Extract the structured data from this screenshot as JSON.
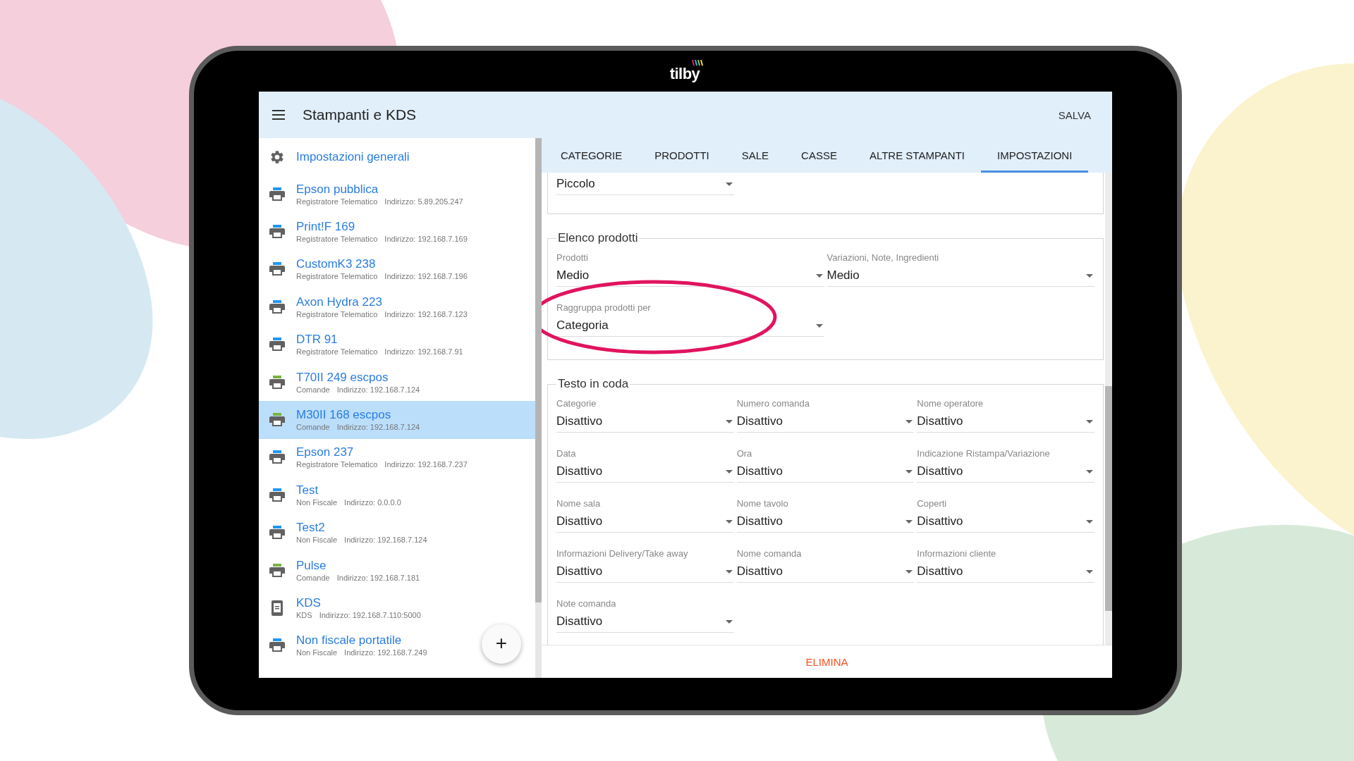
{
  "device_logo": "tilby",
  "app_bar": {
    "title": "Stampanti e KDS",
    "action": "SALVA"
  },
  "sidebar": {
    "items": [
      {
        "kind": "settings",
        "name": "Impostazioni generali",
        "selected": false
      },
      {
        "kind": "printer",
        "name": "Epson pubblica",
        "type": "Registratore Telematico",
        "address": "Indirizzo: 5.89.205.247",
        "color": "#2196f3",
        "selected": false
      },
      {
        "kind": "printer",
        "name": "Print!F 169",
        "type": "Registratore Telematico",
        "address": "Indirizzo: 192.168.7.169",
        "color": "#2196f3",
        "selected": false
      },
      {
        "kind": "printer",
        "name": "CustomK3 238",
        "type": "Registratore Telematico",
        "address": "Indirizzo: 192.168.7.196",
        "color": "#2196f3",
        "selected": false
      },
      {
        "kind": "printer",
        "name": "Axon Hydra 223",
        "type": "Registratore Telematico",
        "address": "Indirizzo: 192.168.7.123",
        "color": "#2196f3",
        "selected": false
      },
      {
        "kind": "printer",
        "name": "DTR 91",
        "type": "Registratore Telematico",
        "address": "Indirizzo: 192.168.7.91",
        "color": "#2196f3",
        "selected": false
      },
      {
        "kind": "printer",
        "name": "T70II 249 escpos",
        "type": "Comande",
        "address": "Indirizzo: 192.168.7.124",
        "color": "#7cb342",
        "selected": false
      },
      {
        "kind": "printer",
        "name": "M30II 168 escpos",
        "type": "Comande",
        "address": "Indirizzo: 192.168.7.124",
        "color": "#7cb342",
        "selected": true
      },
      {
        "kind": "printer",
        "name": "Epson 237",
        "type": "Registratore Telematico",
        "address": "Indirizzo: 192.168.7.237",
        "color": "#2196f3",
        "selected": false
      },
      {
        "kind": "printer",
        "name": "Test",
        "type": "Non Fiscale",
        "address": "Indirizzo: 0.0.0.0",
        "color": "#2196f3",
        "selected": false
      },
      {
        "kind": "printer",
        "name": "Test2",
        "type": "Non Fiscale",
        "address": "Indirizzo: 192.168.7.124",
        "color": "#2196f3",
        "selected": false
      },
      {
        "kind": "printer",
        "name": "Pulse",
        "type": "Comande",
        "address": "Indirizzo: 192.168.7.181",
        "color": "#7cb342",
        "selected": false
      },
      {
        "kind": "kds",
        "name": "KDS",
        "type": "KDS",
        "address": "Indirizzo: 192.168.7.110:5000",
        "selected": false
      },
      {
        "kind": "printer",
        "name": "Non fiscale portatile",
        "type": "Non Fiscale",
        "address": "Indirizzo: 192.168.7.249",
        "color": "#2196f3",
        "selected": false
      }
    ],
    "add_button": "+"
  },
  "tabs": [
    {
      "label": "CATEGORIE",
      "selected": false
    },
    {
      "label": "PRODOTTI",
      "selected": false
    },
    {
      "label": "SALE",
      "selected": false
    },
    {
      "label": "CASSE",
      "selected": false
    },
    {
      "label": "ALTRE STAMPANTI",
      "selected": false
    },
    {
      "label": "IMPOSTAZIONI",
      "selected": true
    }
  ],
  "sections": [
    {
      "kind": "three",
      "fields": [
        {
          "value": "Piccolo"
        }
      ]
    },
    {
      "kind": "two",
      "legend": "Elenco prodotti",
      "fields": [
        {
          "label": "Prodotti",
          "value": "Medio"
        },
        {
          "label": "Variazioni, Note, Ingredienti",
          "value": "Medio"
        },
        {
          "label": "Raggruppa prodotti per",
          "value": "Categoria",
          "highlighted": true
        }
      ]
    },
    {
      "kind": "three",
      "legend": "Testo in coda",
      "fields": [
        {
          "label": "Categorie",
          "value": "Disattivo"
        },
        {
          "label": "Numero comanda",
          "value": "Disattivo"
        },
        {
          "label": "Nome operatore",
          "value": "Disattivo"
        },
        {
          "label": "Data",
          "value": "Disattivo"
        },
        {
          "label": "Ora",
          "value": "Disattivo"
        },
        {
          "label": "Indicazione Ristampa/Variazione",
          "value": "Disattivo"
        },
        {
          "label": "Nome sala",
          "value": "Disattivo"
        },
        {
          "label": "Nome tavolo",
          "value": "Disattivo"
        },
        {
          "label": "Coperti",
          "value": "Disattivo"
        },
        {
          "label": "Informazioni Delivery/Take away",
          "value": "Disattivo"
        },
        {
          "label": "Nome comanda",
          "value": "Disattivo"
        },
        {
          "label": "Informazioni cliente",
          "value": "Disattivo"
        },
        {
          "label": "Note comanda",
          "value": "Disattivo"
        }
      ]
    }
  ],
  "delete_button": "ELIMINA"
}
